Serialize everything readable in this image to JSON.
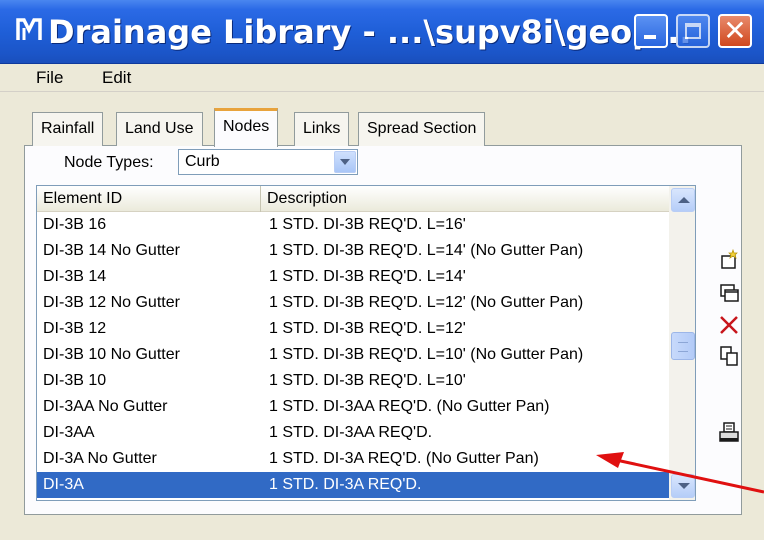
{
  "window": {
    "title": "Drainage Library - ...\\supv8i\\geop...",
    "app_icon": "app-logo-icon"
  },
  "menu": {
    "file": "File",
    "edit": "Edit"
  },
  "tabs": [
    {
      "label": "Rainfall",
      "active": false
    },
    {
      "label": "Land Use",
      "active": false
    },
    {
      "label": "Nodes",
      "active": true
    },
    {
      "label": "Links",
      "active": false
    },
    {
      "label": "Spread Section",
      "active": false
    }
  ],
  "node_types": {
    "label": "Node Types:",
    "value": "Curb"
  },
  "list": {
    "columns": [
      "Element ID",
      "Description"
    ],
    "rows": [
      {
        "id": "DI-3B 16",
        "desc": "1 STD. DI-3B REQ'D. L=16'"
      },
      {
        "id": "DI-3B 14 No Gutter",
        "desc": "1 STD. DI-3B REQ'D. L=14'  (No Gutter Pan)"
      },
      {
        "id": "DI-3B 14",
        "desc": "1 STD. DI-3B REQ'D. L=14'"
      },
      {
        "id": "DI-3B 12 No Gutter",
        "desc": "1 STD. DI-3B REQ'D. L=12'  (No Gutter Pan)"
      },
      {
        "id": "DI-3B 12",
        "desc": "1 STD. DI-3B REQ'D. L=12'"
      },
      {
        "id": "DI-3B 10 No Gutter",
        "desc": "1 STD. DI-3B REQ'D. L=10'  (No Gutter Pan)"
      },
      {
        "id": "DI-3B 10",
        "desc": "1 STD. DI-3B REQ'D. L=10'"
      },
      {
        "id": "DI-3AA No Gutter",
        "desc": "1 STD. DI-3AA REQ'D.  (No Gutter Pan)"
      },
      {
        "id": "DI-3AA",
        "desc": "1 STD. DI-3AA REQ'D."
      },
      {
        "id": "DI-3A No Gutter",
        "desc": "1 STD. DI-3A REQ'D.  (No Gutter Pan)"
      },
      {
        "id": "DI-3A",
        "desc": "1 STD. DI-3A REQ'D.",
        "selected": true
      }
    ]
  },
  "side_tools": [
    {
      "icon": "new-item-icon"
    },
    {
      "icon": "copy-window-icon"
    },
    {
      "icon": "delete-icon"
    },
    {
      "icon": "duplicate-icon"
    },
    {
      "icon": "print-icon"
    }
  ],
  "colors": {
    "titlebar": "#2360d8",
    "selection": "#316ac5",
    "annotation_arrow": "#e01010",
    "active_tab_accent": "#e8a33c"
  }
}
